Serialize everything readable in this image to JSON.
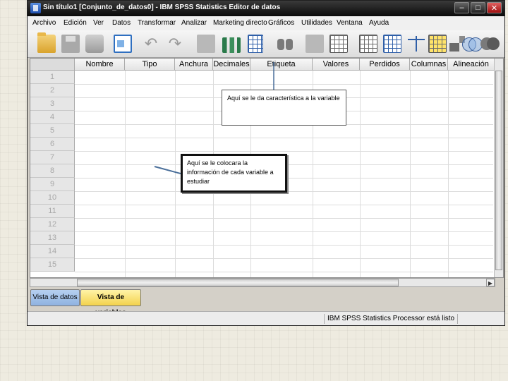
{
  "window": {
    "title": "Sin título1 [Conjunto_de_datos0] - IBM SPSS Statistics Editor de datos"
  },
  "window_controls": {
    "minimize": "–",
    "maximize": "□",
    "close": "✕"
  },
  "menu": [
    "Archivo",
    "Edición",
    "Ver",
    "Datos",
    "Transformar",
    "Analizar",
    "Marketing directo",
    "Gráficos",
    "Utilidades",
    "Ventana",
    "Ayuda"
  ],
  "toolbar": {
    "icons": [
      "open-folder-icon",
      "save-icon",
      "print-icon",
      "recall-dialog-icon",
      "undo-icon",
      "redo-icon",
      "goto-case-icon",
      "goto-variable-icon",
      "variables-icon",
      "find-icon",
      "insert-cases-icon",
      "insert-variable-icon",
      "split-file-icon",
      "weight-cases-icon",
      "select-cases-icon",
      "value-labels-icon",
      "use-variable-sets-icon",
      "show-all-variables-icon",
      "spell-check-icon"
    ],
    "undo_glyph": "↶",
    "redo_glyph": "↷"
  },
  "grid": {
    "columns": [
      "Nombre",
      "Tipo",
      "Anchura",
      "Decimales",
      "Etiqueta",
      "Valores",
      "Perdidos",
      "Columnas",
      "Alineación"
    ],
    "rows": [
      "1",
      "2",
      "3",
      "4",
      "5",
      "6",
      "7",
      "8",
      "9",
      "10",
      "11",
      "12",
      "13",
      "14",
      "15"
    ]
  },
  "scroll": {
    "left_arrow": "◀",
    "right_arrow": "▶"
  },
  "tabs": {
    "data_view": "Vista de datos",
    "variable_view": "Vista de variables",
    "active": "variable_view"
  },
  "status": {
    "processor": "IBM SPSS Statistics Processor está listo"
  },
  "annotations": {
    "etiqueta_note": "Aquí se le da característica a la variable",
    "info_note": "Aquí se le colocara la información de cada variable a estudiar"
  },
  "colors": {
    "tab_active": "#f3d24c",
    "tab_inactive": "#8fb2e0",
    "titlebar": "#0a0a0a"
  }
}
